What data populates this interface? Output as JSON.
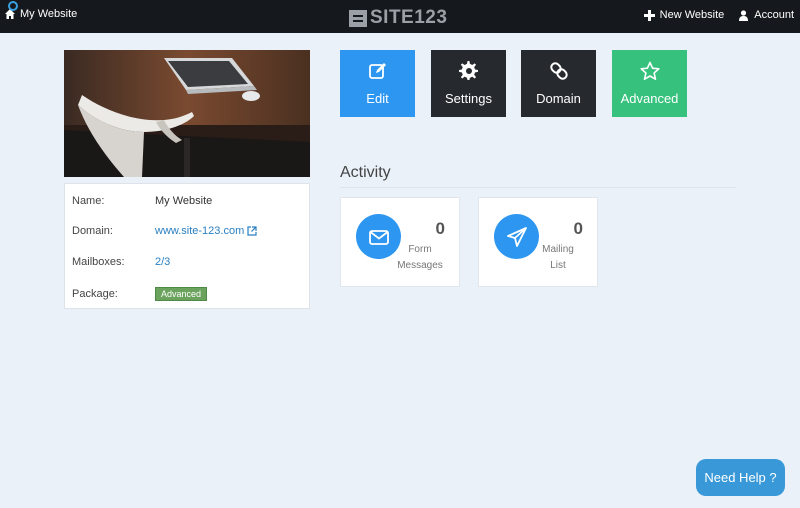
{
  "topbar": {
    "site_name": "My Website",
    "brand": "SITE123",
    "new_website": "New Website",
    "account": "Account"
  },
  "actions": {
    "edit": "Edit",
    "settings": "Settings",
    "domain": "Domain",
    "advanced": "Advanced"
  },
  "info": {
    "rows": [
      {
        "label": "Name:",
        "value": "My Website"
      },
      {
        "label": "Domain:",
        "value": "www.site-123.com"
      },
      {
        "label": "Mailboxes:",
        "value": "2/3"
      },
      {
        "label": "Package:",
        "value": "Advanced"
      }
    ]
  },
  "activity": {
    "title": "Activity",
    "cards": [
      {
        "count": "0",
        "label_line1": "Form",
        "label_line2": "Messages",
        "icon": "envelope-icon"
      },
      {
        "count": "0",
        "label_line1": "Mailing",
        "label_line2": "List",
        "icon": "paper-plane-icon"
      }
    ]
  },
  "help": {
    "label": "Need Help ?"
  },
  "colors": {
    "topbar": "#15191d",
    "edit": "#2d96f0",
    "dark_tile": "#262a2e",
    "advanced": "#36c17d",
    "badge": "#6ba35e",
    "help": "#3898d8",
    "background": "#eaf1f8"
  }
}
